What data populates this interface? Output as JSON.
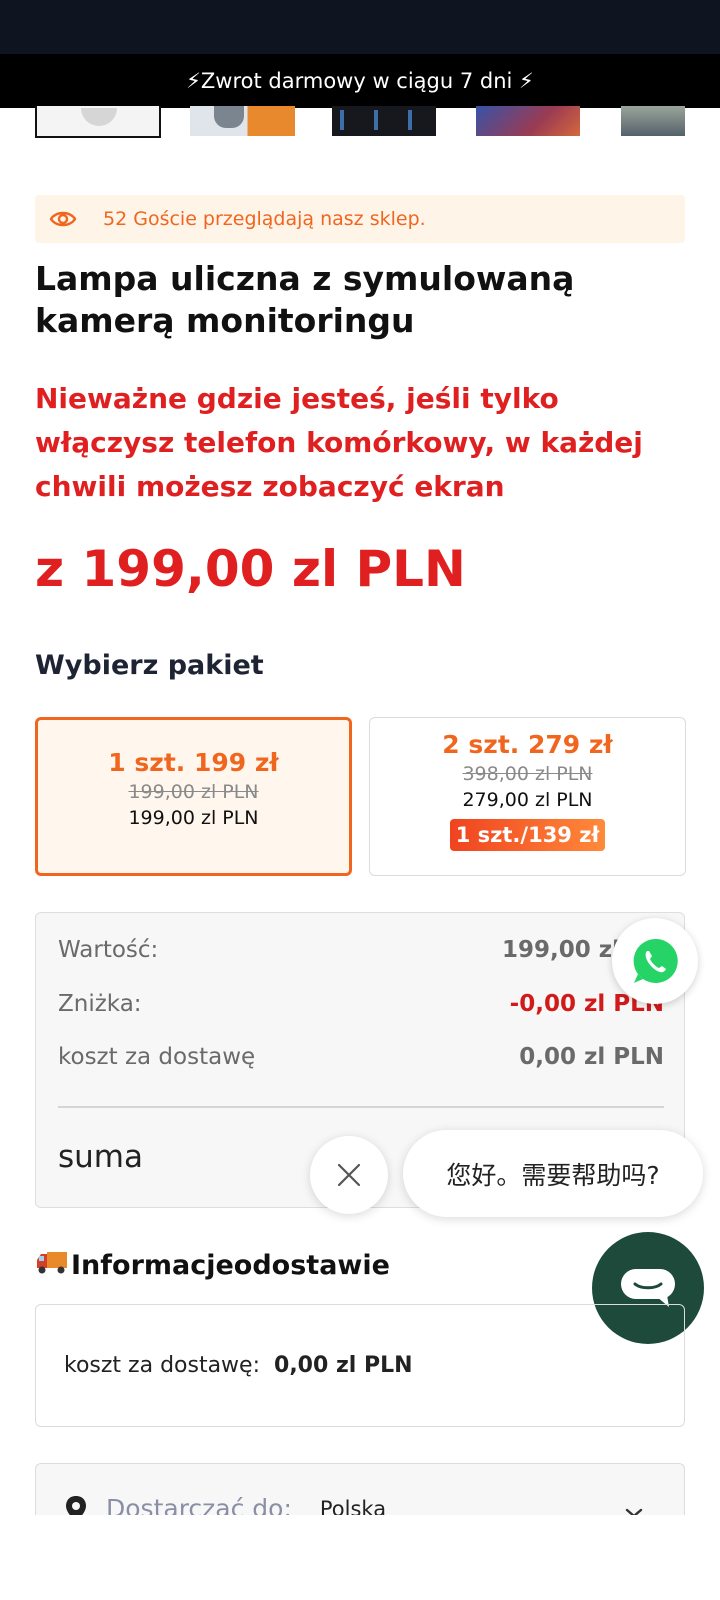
{
  "announcement": {
    "text": "⚡Zwrot darmowy w ciągu 7 dni ⚡"
  },
  "thumbnails": [
    {
      "icon": "product-thumbnail-camera"
    },
    {
      "icon": "product-thumbnail-lamp"
    },
    {
      "icon": "product-thumbnail-install"
    },
    {
      "icon": "product-thumbnail-solar"
    },
    {
      "icon": "product-thumbnail-scene"
    }
  ],
  "visitors": {
    "icon": "eye-icon",
    "text": "52 Goście przeglądają nasz sklep."
  },
  "product": {
    "title": "Lampa uliczna z symulowaną kamerą monitoringu",
    "subtitle": "Nieważne gdzie jesteś, jeśli tylko włączysz telefon komórkowy, w każdej chwili możesz zobaczyć ekran",
    "price": "z 199,00 zl PLN"
  },
  "packages": {
    "heading": "Wybierz pakiet",
    "options": [
      {
        "name": "1 szt. 199 zł",
        "old_price": "199,00 zl PLN",
        "price": "199,00 zl PLN",
        "badge": "",
        "selected": true
      },
      {
        "name": "2 szt. 279 zł",
        "old_price": "398,00 zl PLN",
        "price": "279,00 zl PLN",
        "badge": "1 szt./139 zł",
        "selected": false
      }
    ]
  },
  "summary": {
    "value_label": "Wartość:",
    "value": "199,00 zl",
    "discount_label": "Zniżka:",
    "discount": "-0,00 zl PLN",
    "shipping_label": "koszt za dostawę",
    "shipping": "0,00 zl PLN",
    "total_label": "suma"
  },
  "chat": {
    "greeting": "您好。需要帮助吗?"
  },
  "shipping_info": {
    "heading": "Informacjeodostawie",
    "cost_label": "koszt za dostawę:",
    "cost": "0,00 zl PLN"
  },
  "delivery": {
    "label": "Dostarczać do:",
    "country": "Polska"
  },
  "colors": {
    "accent": "#f0661f",
    "price_red": "#e02020",
    "chat_green": "#1d4a3b",
    "whatsapp_green": "#25d366"
  }
}
